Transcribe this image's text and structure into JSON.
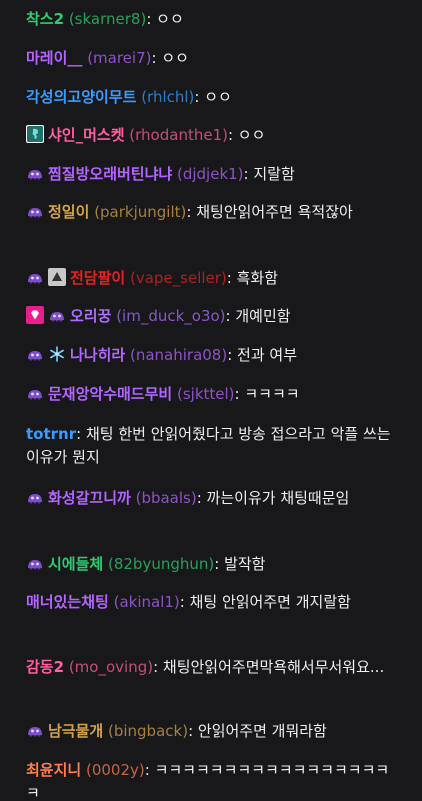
{
  "chat": {
    "messages": [
      {
        "name": "착스2",
        "login": "(skarner8)",
        "text": "ㅇㅇ",
        "color": "#2ecc71",
        "badges": []
      },
      {
        "name": "마레이__",
        "login": "(marei7)",
        "text": "ㅇㅇ",
        "color": "#b366ff",
        "badges": []
      },
      {
        "name": "각성의고양이무트",
        "login": "(rhlchl)",
        "text": "ㅇㅇ",
        "color": "#3a9cff",
        "badges": []
      },
      {
        "name": "샤인_머스켓",
        "login": "(rhodanthe1)",
        "text": "ㅇㅇ",
        "color": "#ff5fa0",
        "badges": [
          "seahorse-badge-icon"
        ]
      },
      {
        "name": "찜질방오래버틴냐냐",
        "login": "(djdjek1)",
        "text": "지랄함",
        "color": "#b366ff",
        "badges": [
          "purple-creature-badge-icon"
        ]
      },
      {
        "name": "정일이",
        "login": "(parkjungilt)",
        "text": "채팅안읽어주면 욕적잖아",
        "color": "#d4a34a",
        "badges": [
          "purple-creature-badge-icon"
        ]
      },
      {
        "name": "전담팔이",
        "login": "(vape_seller)",
        "text": "흑화함",
        "color": "#e02424",
        "badges": [
          "purple-creature-badge-icon",
          "triangle-badge-icon"
        ]
      },
      {
        "name": "오리꿍",
        "login": "(im_duck_o3o)",
        "text": "개예민함",
        "color": "#a970ff",
        "badges": [
          "diamond-badge-icon",
          "purple-creature-badge-icon"
        ]
      },
      {
        "name": "나나히라",
        "login": "(nanahira08)",
        "text": "전과 여부",
        "color": "#b366ff",
        "badges": [
          "purple-creature-badge-icon",
          "snowflake-badge-icon"
        ]
      },
      {
        "name": "문재앙악수매드무비",
        "login": "(sjkttel)",
        "text": "ㅋㅋㅋㅋ",
        "color": "#b366ff",
        "badges": [
          "purple-creature-badge-icon"
        ]
      },
      {
        "name": "totrnr",
        "login": "",
        "text": "채팅 한번 안읽어줬다고 방송 접으라고 악플 쓰는 이유가 뭔지",
        "color": "#3a9cff",
        "badges": []
      },
      {
        "name": "화성갈끄니까",
        "login": "(bbaals)",
        "text": "까는이유가 채팅때문임",
        "color": "#b366ff",
        "badges": [
          "purple-creature-badge-icon"
        ]
      },
      {
        "name": "시에들체",
        "login": "(82byunghun)",
        "text": "발작함",
        "color": "#2ecc71",
        "badges": [
          "purple-creature-badge-icon"
        ]
      },
      {
        "name": "매너있는채팅",
        "login": "(akinal1)",
        "text": "채팅 안읽어주면 개지랄함",
        "color": "#b366ff",
        "badges": []
      },
      {
        "name": "감동2",
        "login": "(mo_oving)",
        "text": "채팅안읽어주면막욕해서무서워요...",
        "color": "#ff5fa0",
        "badges": []
      },
      {
        "name": "남극물개",
        "login": "(bingback)",
        "text": "안읽어주면 개뭐라함",
        "color": "#d4a34a",
        "badges": [
          "purple-creature-badge-icon"
        ]
      },
      {
        "name": "최윤지니",
        "login": "(0002y)",
        "text": "ㅋㅋㅋㅋㅋㅋㅋㅋㅋㅋㅋㅋㅋㅋㅋㅋㅋㅋ",
        "color": "#ff7f50",
        "badges": []
      }
    ]
  }
}
